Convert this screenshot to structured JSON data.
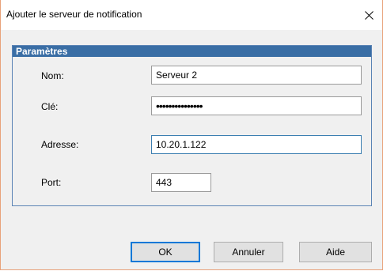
{
  "window": {
    "title": "Ajouter le serveur de notification",
    "close_glyph": "✕"
  },
  "group": {
    "title": "Paramètres"
  },
  "fields": {
    "name_label": "Nom:",
    "name_value": "Serveur 2",
    "key_label": "Clé:",
    "key_value": "•••••••••••••••",
    "address_label": "Adresse:",
    "address_value": "10.20.1.122",
    "port_label": "Port:",
    "port_value": "443"
  },
  "buttons": {
    "ok": "OK",
    "cancel": "Annuler",
    "help": "Aide"
  },
  "colors": {
    "group_header": "#3a6ea5",
    "focus_border": "#3c7fb1",
    "default_button_border": "#0078d7",
    "window_border": "#e8a27a"
  }
}
